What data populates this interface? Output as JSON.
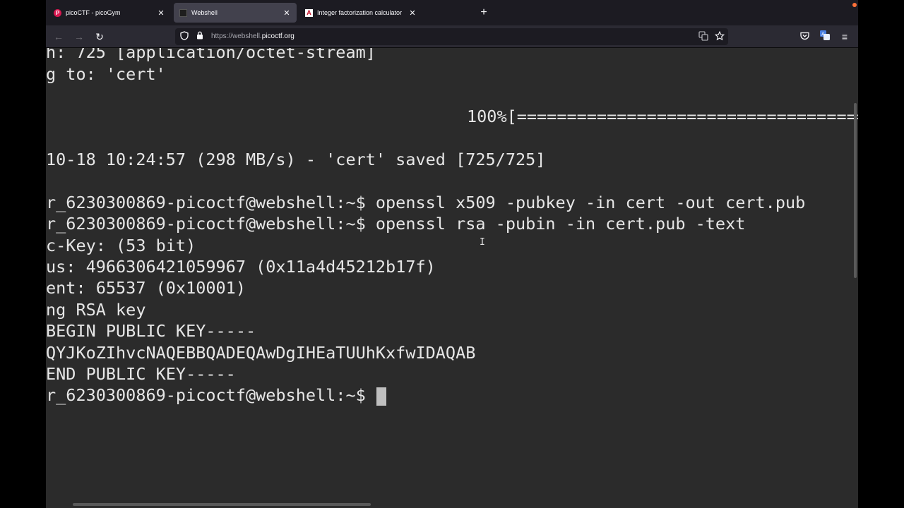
{
  "browser": {
    "tabs": [
      {
        "title": "picoCTF - picoGym",
        "favicon": "picoctf-icon",
        "active": false
      },
      {
        "title": "Webshell",
        "favicon": "terminal-icon",
        "active": true
      },
      {
        "title": "Integer factorization calculator",
        "favicon": "alpertron-icon",
        "active": false
      }
    ],
    "new_tab_glyph": "+",
    "close_glyph": "✕",
    "url_scheme": "https://webshell.",
    "url_domain": "picoctf.org"
  },
  "terminal": {
    "lines": [
      "h: 725 [application/octet-stream]",
      "g to: 'cert'",
      "",
      "100%[=================================================",
      "",
      "10-18 10:24:57 (298 MB/s) - 'cert' saved [725/725]",
      "",
      "r_6230300869-picoctf@webshell:~$ openssl x509 -pubkey -in cert -out cert.pub",
      "r_6230300869-picoctf@webshell:~$ openssl rsa -pubin -in cert.pub -text",
      "c-Key: (53 bit)",
      "us: 4966306421059967 (0x11a4d45212b17f)",
      "ent: 65537 (0x10001)",
      "ng RSA key",
      "BEGIN PUBLIC KEY-----",
      "QYJKoZIhvcNAQEBBQADEQAwDgIHEaTUUhKxfwIDAQAB",
      "END PUBLIC KEY-----",
      "r_6230300869-picoctf@webshell:~$ "
    ]
  },
  "colors": {
    "terminal_bg": "#2b2b2b",
    "terminal_fg": "#e6e6e6",
    "tab_active": "#42414d",
    "toolbar": "#2b2a33"
  }
}
